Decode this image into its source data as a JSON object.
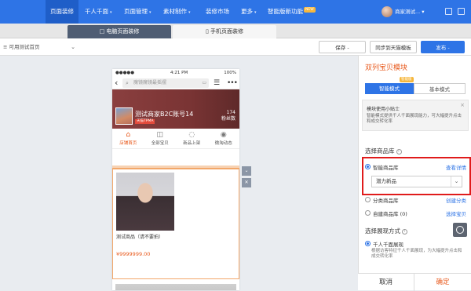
{
  "topnav": {
    "items": [
      {
        "label": "页面装修",
        "caret": ""
      },
      {
        "label": "千人千面",
        "caret": "▾"
      },
      {
        "label": "页面管理",
        "caret": "▾"
      },
      {
        "label": "素材制作",
        "caret": "▾"
      },
      {
        "label": "装修市场",
        "caret": ""
      },
      {
        "label": "更多",
        "caret": "▾"
      },
      {
        "label": "智能版新功能",
        "caret": ""
      }
    ],
    "new_badge": "NEW",
    "user_name": "商家测试...",
    "user_caret": "▾"
  },
  "tabs": [
    {
      "icon": "□",
      "label": "电脑页面装修"
    },
    {
      "icon": "▯",
      "label": "手机页面装修"
    }
  ],
  "toolbar": {
    "page_select": "≡ 可用测试首页",
    "page_select_chev": "⌄",
    "save_label": "保存 -",
    "sync_label": "同步到天猫模板",
    "publish_label": "发布 -"
  },
  "phone": {
    "status_left": "●●●●●",
    "status_time": "4:21 PM",
    "status_battery": "100%",
    "back": "‹",
    "search_icon": "⌕",
    "search_placeholder": "魔镜魔镜最摇摆",
    "scan_icon": "▭",
    "list_icon": "☰",
    "more_icon": "•••",
    "shop_name": "测试商家B2C账号14",
    "shop_tag": "天猫TPMA",
    "fans_count": "174",
    "fans_label": "粉丝数",
    "nav": [
      {
        "icon": "⌂",
        "label": "店铺首页"
      },
      {
        "icon": "◫",
        "label": "全部宝贝"
      },
      {
        "icon": "◌",
        "label": "新品上架"
      },
      {
        "icon": "◉",
        "label": "微淘动态"
      }
    ],
    "product_title": "测试商品（请不要拍）",
    "product_price": "¥9999999.00"
  },
  "side_controls": {
    "down": "⌄",
    "close": "✕"
  },
  "panel": {
    "title": "双列宝贝模块",
    "mode_smart": "智能模式",
    "mode_basic": "基本模式",
    "mode_badge": "智能版",
    "tip_title": "模块使用小贴士",
    "tip_text": "智能模式提供千人千面展现能力，可大幅提升点击和成交转化率",
    "tip_close": "×",
    "source_label": "选择商品库",
    "info": "i",
    "opt_smart": "智能商品库",
    "opt_smart_link": "查看详情",
    "smart_select_value": "潜力新品",
    "opt_category": "分类商品库",
    "opt_category_link": "创建分类",
    "opt_custom": "自建商品库 (0)",
    "opt_custom_link": "选择宝贝",
    "display_label": "选择展现方式",
    "opt_personal": "千人千面展现",
    "personal_desc": "根据访客特征千人千面展现，为大幅提升点击和成交转化率",
    "cancel_label": "取消",
    "confirm_label": "确定"
  },
  "colors": {
    "brand": "#2e74e6",
    "accent": "#e8591c",
    "highlight": "#e01b1b"
  }
}
